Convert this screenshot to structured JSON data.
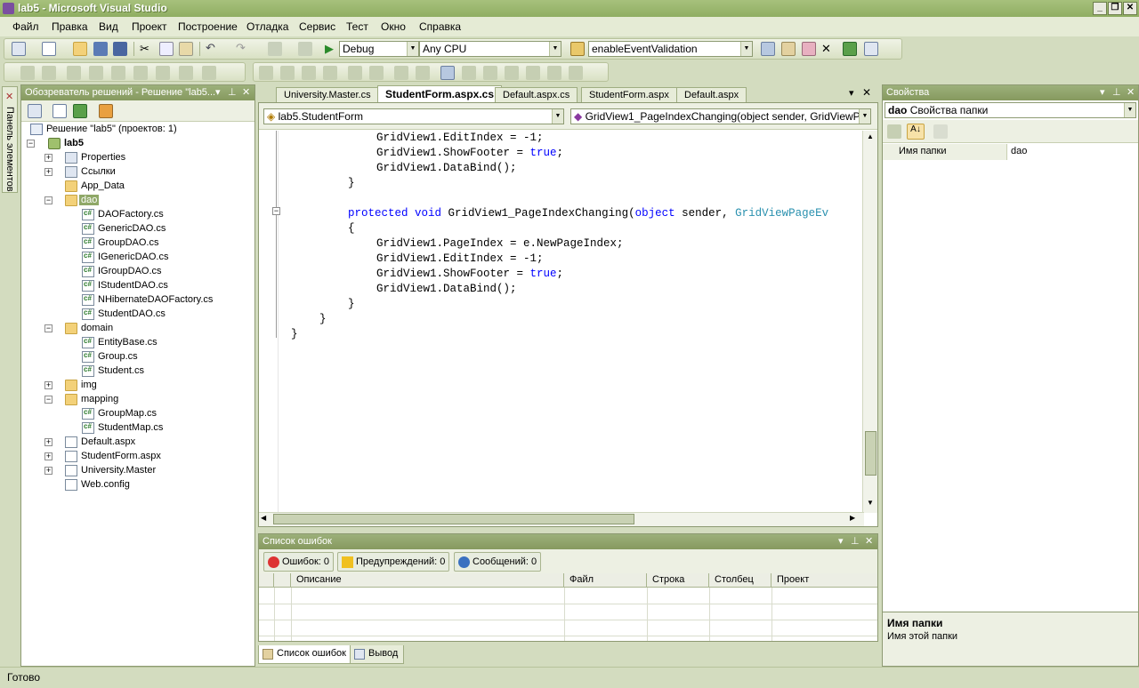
{
  "window": {
    "title": "lab5 - Microsoft Visual Studio"
  },
  "menu": [
    "Файл",
    "Правка",
    "Вид",
    "Проект",
    "Построение",
    "Отладка",
    "Сервис",
    "Тест",
    "Окно",
    "Справка"
  ],
  "toolbar": {
    "config": "Debug",
    "platform": "Any CPU",
    "find": "enableEventValidation"
  },
  "toolbox": {
    "label": "Панель элементов"
  },
  "solution_explorer": {
    "title": "Обозреватель решений - Решение \"lab5...",
    "solution": "Решение \"lab5\" (проектов: 1)",
    "project": "lab5",
    "items": {
      "properties": "Properties",
      "references": "Ссылки",
      "app_data": "App_Data",
      "dao": "dao",
      "daofactory": "DAOFactory.cs",
      "genericdao": "GenericDAO.cs",
      "groupdao": "GroupDAO.cs",
      "igenericdao": "IGenericDAO.cs",
      "igroupdao": "IGroupDAO.cs",
      "istudentdao": "IStudentDAO.cs",
      "nhibernatedaofactory": "NHibernateDAOFactory.cs",
      "studentdao": "StudentDAO.cs",
      "domain": "domain",
      "entitybase": "EntityBase.cs",
      "group": "Group.cs",
      "student": "Student.cs",
      "img": "img",
      "mapping": "mapping",
      "groupmap": "GroupMap.cs",
      "studentmap": "StudentMap.cs",
      "default_aspx": "Default.aspx",
      "studentform_aspx": "StudentForm.aspx",
      "university_master": "University.Master",
      "web_config": "Web.config"
    }
  },
  "editor": {
    "tabs": [
      "University.Master.cs",
      "StudentForm.aspx.cs",
      "Default.aspx.cs",
      "StudentForm.aspx",
      "Default.aspx"
    ],
    "active_tab": "StudentForm.aspx.cs",
    "class_combo": "lab5.StudentForm",
    "member_combo": "GridView1_PageIndexChanging(object sender, GridViewPageEv",
    "code": {
      "l1": "GridView1.EditIndex = -1;",
      "l2a": "GridView1.ShowFooter = ",
      "l2b": "true",
      "l2c": ";",
      "l3": "GridView1.DataBind();",
      "l4": "}",
      "l5a": "protected",
      "l5b": "void",
      "l5c": " GridView1_PageIndexChanging(",
      "l5d": "object",
      "l5e": " sender, ",
      "l5f": "GridViewPageEv",
      "l6": "{",
      "l7": "GridView1.PageIndex = e.NewPageIndex;",
      "l8": "GridView1.EditIndex = -1;",
      "l9a": "GridView1.ShowFooter = ",
      "l9b": "true",
      "l9c": ";",
      "l10": "GridView1.DataBind();",
      "l11": "}",
      "l12": "}",
      "l13": "}"
    }
  },
  "error_list": {
    "title": "Список ошибок",
    "errors": "Ошибок: 0",
    "warnings": "Предупреждений: 0",
    "messages": "Сообщений: 0",
    "columns": [
      "Описание",
      "Файл",
      "Строка",
      "Столбец",
      "Проект"
    ]
  },
  "bottom_tabs": [
    "Список ошибок",
    "Вывод"
  ],
  "properties": {
    "title": "Свойства",
    "object_name": "dao",
    "object_type": "Свойства папки",
    "prop_name": "Имя папки",
    "prop_value": "dao",
    "desc_title": "Имя папки",
    "desc_text": "Имя этой папки"
  },
  "status": {
    "text": "Готово"
  }
}
